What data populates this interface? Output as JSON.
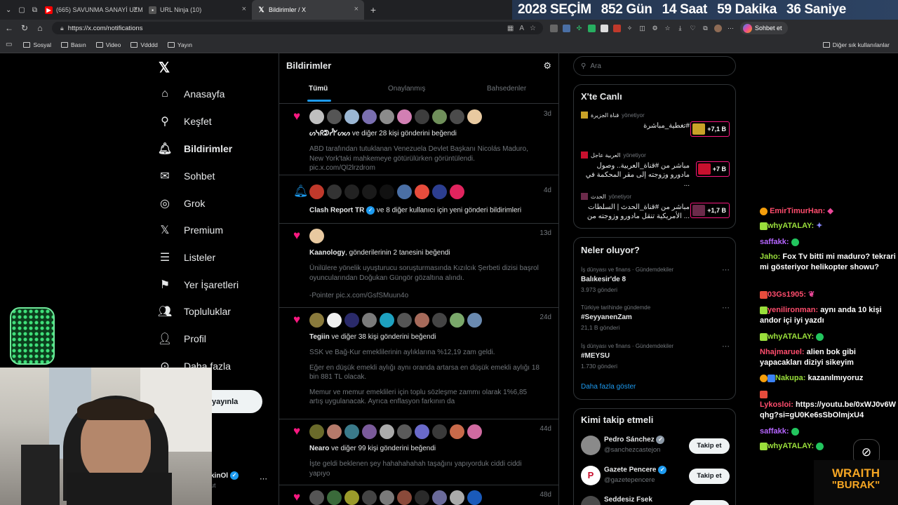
{
  "browser": {
    "tabs": [
      {
        "label": "(665) SAVUNMA SANAYİ UZMANI",
        "favicon": "youtube-icon",
        "color": "#ff0000"
      },
      {
        "label": "URL Ninja (10)",
        "favicon": "url-ninja-icon",
        "color": "#888888"
      },
      {
        "label": "Bildirimler / X",
        "favicon": "x-logo-icon",
        "color": "#ffffff"
      }
    ],
    "new_tab": "+",
    "url": "https://x.com/notifications",
    "copilot_label": "Sohbet et",
    "bookmarks": [
      "Sosyal",
      "Basın",
      "Video",
      "Vdddd",
      "Yayın"
    ],
    "bookmarks_right": "Diğer sık kullanılanlar"
  },
  "countdown": {
    "title": "2028 SEÇİM",
    "days": "852 Gün",
    "hours": "14 Saat",
    "minutes": "59 Dakika",
    "seconds": "36 Saniye"
  },
  "nav": {
    "items": [
      {
        "label": "Anasayfa",
        "icon": "home-icon"
      },
      {
        "label": "Keşfet",
        "icon": "search-icon"
      },
      {
        "label": "Bildirimler",
        "icon": "bell-icon"
      },
      {
        "label": "Sohbet",
        "icon": "mail-icon"
      },
      {
        "label": "Grok",
        "icon": "grok-icon"
      },
      {
        "label": "Premium",
        "icon": "x-icon"
      },
      {
        "label": "Listeler",
        "icon": "list-icon"
      },
      {
        "label": "Yer İşaretleri",
        "icon": "bookmark-icon"
      },
      {
        "label": "Topluluklar",
        "icon": "people-icon"
      },
      {
        "label": "Profil",
        "icon": "person-icon"
      },
      {
        "label": "Daha fazla",
        "icon": "more-icon"
      }
    ],
    "post_button": "yayınla",
    "account_name": "kinOl",
    "account_handle": "ut"
  },
  "main": {
    "title": "Bildirimler",
    "tabs": [
      "Tümü",
      "Onaylanmış",
      "Bahsedenler"
    ],
    "notifications": [
      {
        "type": "like",
        "time": "3d",
        "who": "ᔕᓭᖇᕲᓮᖼᔕᔕ",
        "text": " ve diğer 28 kişi gönderini beğendi",
        "body": [
          "ABD tarafından tutuklanan Venezuela Devlet Başkanı Nicolás Maduro, New York'taki mahkemeye götürülürken görüntülendi.",
          "pic.x.com/Ql2lrzdrom"
        ]
      },
      {
        "type": "bell",
        "time": "4d",
        "who": "Clash Report TR",
        "text": " ve 8 diğer kullanıcı için yeni gönderi bildirimleri",
        "body": []
      },
      {
        "type": "like",
        "time": "13d",
        "who": "Kaanology",
        "text": ", gönderilerinin 2 tanesini beğendi",
        "body": [
          "Ünilülere yönelik uyuşturucu soruşturmasında Kızılcık Şerbeti dizisi başrol oyuncularından Doğukan Güngör gözaltına alındı.",
          "",
          "-Pointer pic.x.com/GsfSMuun4o"
        ]
      },
      {
        "type": "like",
        "time": "24d",
        "who": "Tegiin",
        "text": " ve diğer 38 kişi gönderini beğendi",
        "body": [
          "SSK ve Bağ-Kur emeklilerinin aylıklarına %12,19 zam geldi.",
          "",
          "Eğer en düşük emekli aylığı aynı oranda artarsa en düşük emekli aylığı 18 bin 881 TL olacak.",
          "",
          "Memur ve memur emeklileri için toplu sözleşme zammı olarak 1%6,85 artış uygulanacak. Ayrıca enflasyon farkının da"
        ]
      },
      {
        "type": "like",
        "time": "44d",
        "who": "Nearo",
        "text": " ve diğer 99 kişi gönderini beğendi",
        "body": [
          "İşte geldi beklenen şey hahahahahah taşağını yapıyorduk ciddi ciddi yapıyo"
        ]
      },
      {
        "type": "like",
        "time": "48d",
        "who": "",
        "text": "",
        "body": []
      }
    ]
  },
  "right": {
    "search_placeholder": "Ara",
    "live_title": "X'te Canlı",
    "live": [
      {
        "channel": "قناة الجزيرة",
        "status": "yönetiyor",
        "headline": "تغطية_مباشرة#",
        "count": "+7,1 B",
        "thumb": "#c9a227"
      },
      {
        "channel": "العربية عاجل",
        "status": "yönetiyor",
        "headline": "مباشر من #قناة_العربية.. وصول مادورو وزوجته إلى مقر المحكمة في ...",
        "count": "+7 B",
        "thumb": "#c8102e"
      },
      {
        "channel": "الحدث",
        "status": "yönetiyor",
        "headline": "مباشر من #قناة_الحدث | السلطات الأمريكية تنقل مادورو وزوجته من ...",
        "count": "+1,7 B",
        "thumb": "#6b2a4a"
      }
    ],
    "trends_title": "Neler oluyor?",
    "trends": [
      {
        "category": "İş dünyası ve finans · Gündemdekiler",
        "topic": "Balıkesir'de 8",
        "posts": "3.973 gönderi"
      },
      {
        "category": "Türkiye tarihinde gündemde",
        "topic": "#SeyyanenZam",
        "posts": "21,1 B gönderi"
      },
      {
        "category": "İş dünyası ve finans · Gündemdekiler",
        "topic": "#MEYSU",
        "posts": "1.730 gönderi"
      }
    ],
    "show_more": "Daha fazla göster",
    "wtf_title": "Kimi takip etmeli",
    "wtf": [
      {
        "name": "Pedro Sánchez",
        "handle": "@sanchezcastejon",
        "button": "Takip et",
        "avatar": "#8a8a8a"
      },
      {
        "name": "Gazete Pencere",
        "handle": "@gazetepencere",
        "button": "Takip et",
        "avatar": "#ffffff"
      },
      {
        "name": "Seddesiz Fsek",
        "handle": "",
        "button": "",
        "avatar": "#4a4a4a"
      }
    ]
  },
  "chat": [
    {
      "user": "EmirTimurHan:",
      "color": "#ff4d6d",
      "msg": ""
    },
    {
      "user": "whyATALAY:",
      "color": "#9adf3b",
      "msg": ""
    },
    {
      "user": "saffakk:",
      "color": "#b565ff",
      "msg": ""
    },
    {
      "user": "Jaho:",
      "color": "#9adf3b",
      "msg": "Fox Tv bitti mi maduro? tekrari mi gösteriyor helikopter showu?"
    },
    {
      "user": "03Gs1905:",
      "color": "#ff4d6d",
      "msg": ""
    },
    {
      "user": "yenilironman:",
      "color": "#ff4d6d",
      "msg": "aynı anda 10 kişi andor içi iyi yazdı"
    },
    {
      "user": "whyATALAY:",
      "color": "#9adf3b",
      "msg": ""
    },
    {
      "user": "Nhajmaruel:",
      "color": "#ff4d6d",
      "msg": "alien bok gibi yapacakları diziyi sikeyim"
    },
    {
      "user": "Nakupa:",
      "color": "#9adf3b",
      "msg": "kazanılmıyoruz"
    },
    {
      "user": "Lykosloi:",
      "color": "#ff4d6d",
      "msg": "https://youtu.be/0xWJ0v6Wqhg?si=gU0Ke6sSbOlmjxU4"
    },
    {
      "user": "saffakk:",
      "color": "#b565ff",
      "msg": ""
    },
    {
      "user": "whyATALAY:",
      "color": "#9adf3b",
      "msg": ""
    }
  ],
  "overlay": {
    "logo_line1": "WRAITH",
    "logo_line2": "\"BURAK\""
  }
}
